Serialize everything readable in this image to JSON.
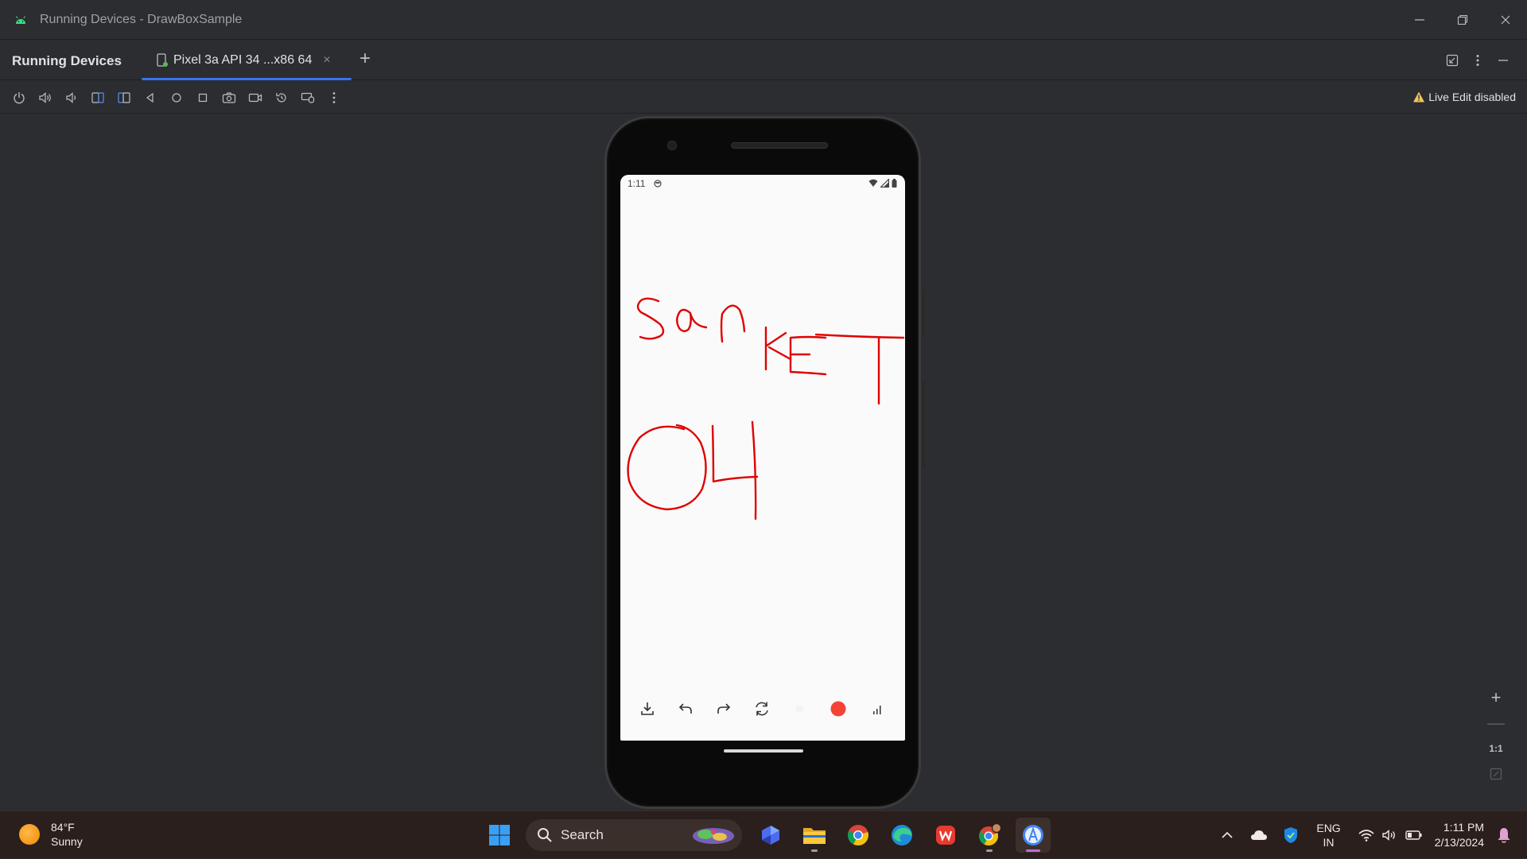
{
  "window": {
    "title": "Running Devices - DrawBoxSample",
    "controls": [
      "minimize",
      "restore",
      "close"
    ]
  },
  "tool_window": {
    "title": "Running Devices",
    "tab_label": "Pixel 3a API 34 ...x86 64",
    "tab_close": "×",
    "add_tab": "+"
  },
  "device_toolbar": {
    "tools": [
      "power-icon",
      "volume-up-icon",
      "volume-down-icon",
      "rotate-left-icon",
      "rotate-right-icon",
      "back-icon",
      "home-icon",
      "overview-icon",
      "screenshot-icon",
      "screen-record-icon",
      "snapshot-icon",
      "mirror-input-icon",
      "more-icon"
    ],
    "live_edit": "Live Edit disabled"
  },
  "phone": {
    "status_time": "1:11",
    "bottom_actions": [
      "download-icon",
      "undo-icon",
      "redo-icon",
      "refresh-icon",
      "brush-size-icon",
      "color-swatch-icon",
      "signal-icon"
    ],
    "color_swatch": "#f44336",
    "stroke_color": "#e00000"
  },
  "zoom": {
    "plus": "+",
    "minus": "—",
    "one_to_one": "1:1"
  },
  "taskbar": {
    "weather_temp": "84°F",
    "weather_desc": "Sunny",
    "search_label": "Search",
    "language_line1": "ENG",
    "language_line2": "IN",
    "time": "1:11 PM",
    "date": "2/13/2024"
  }
}
